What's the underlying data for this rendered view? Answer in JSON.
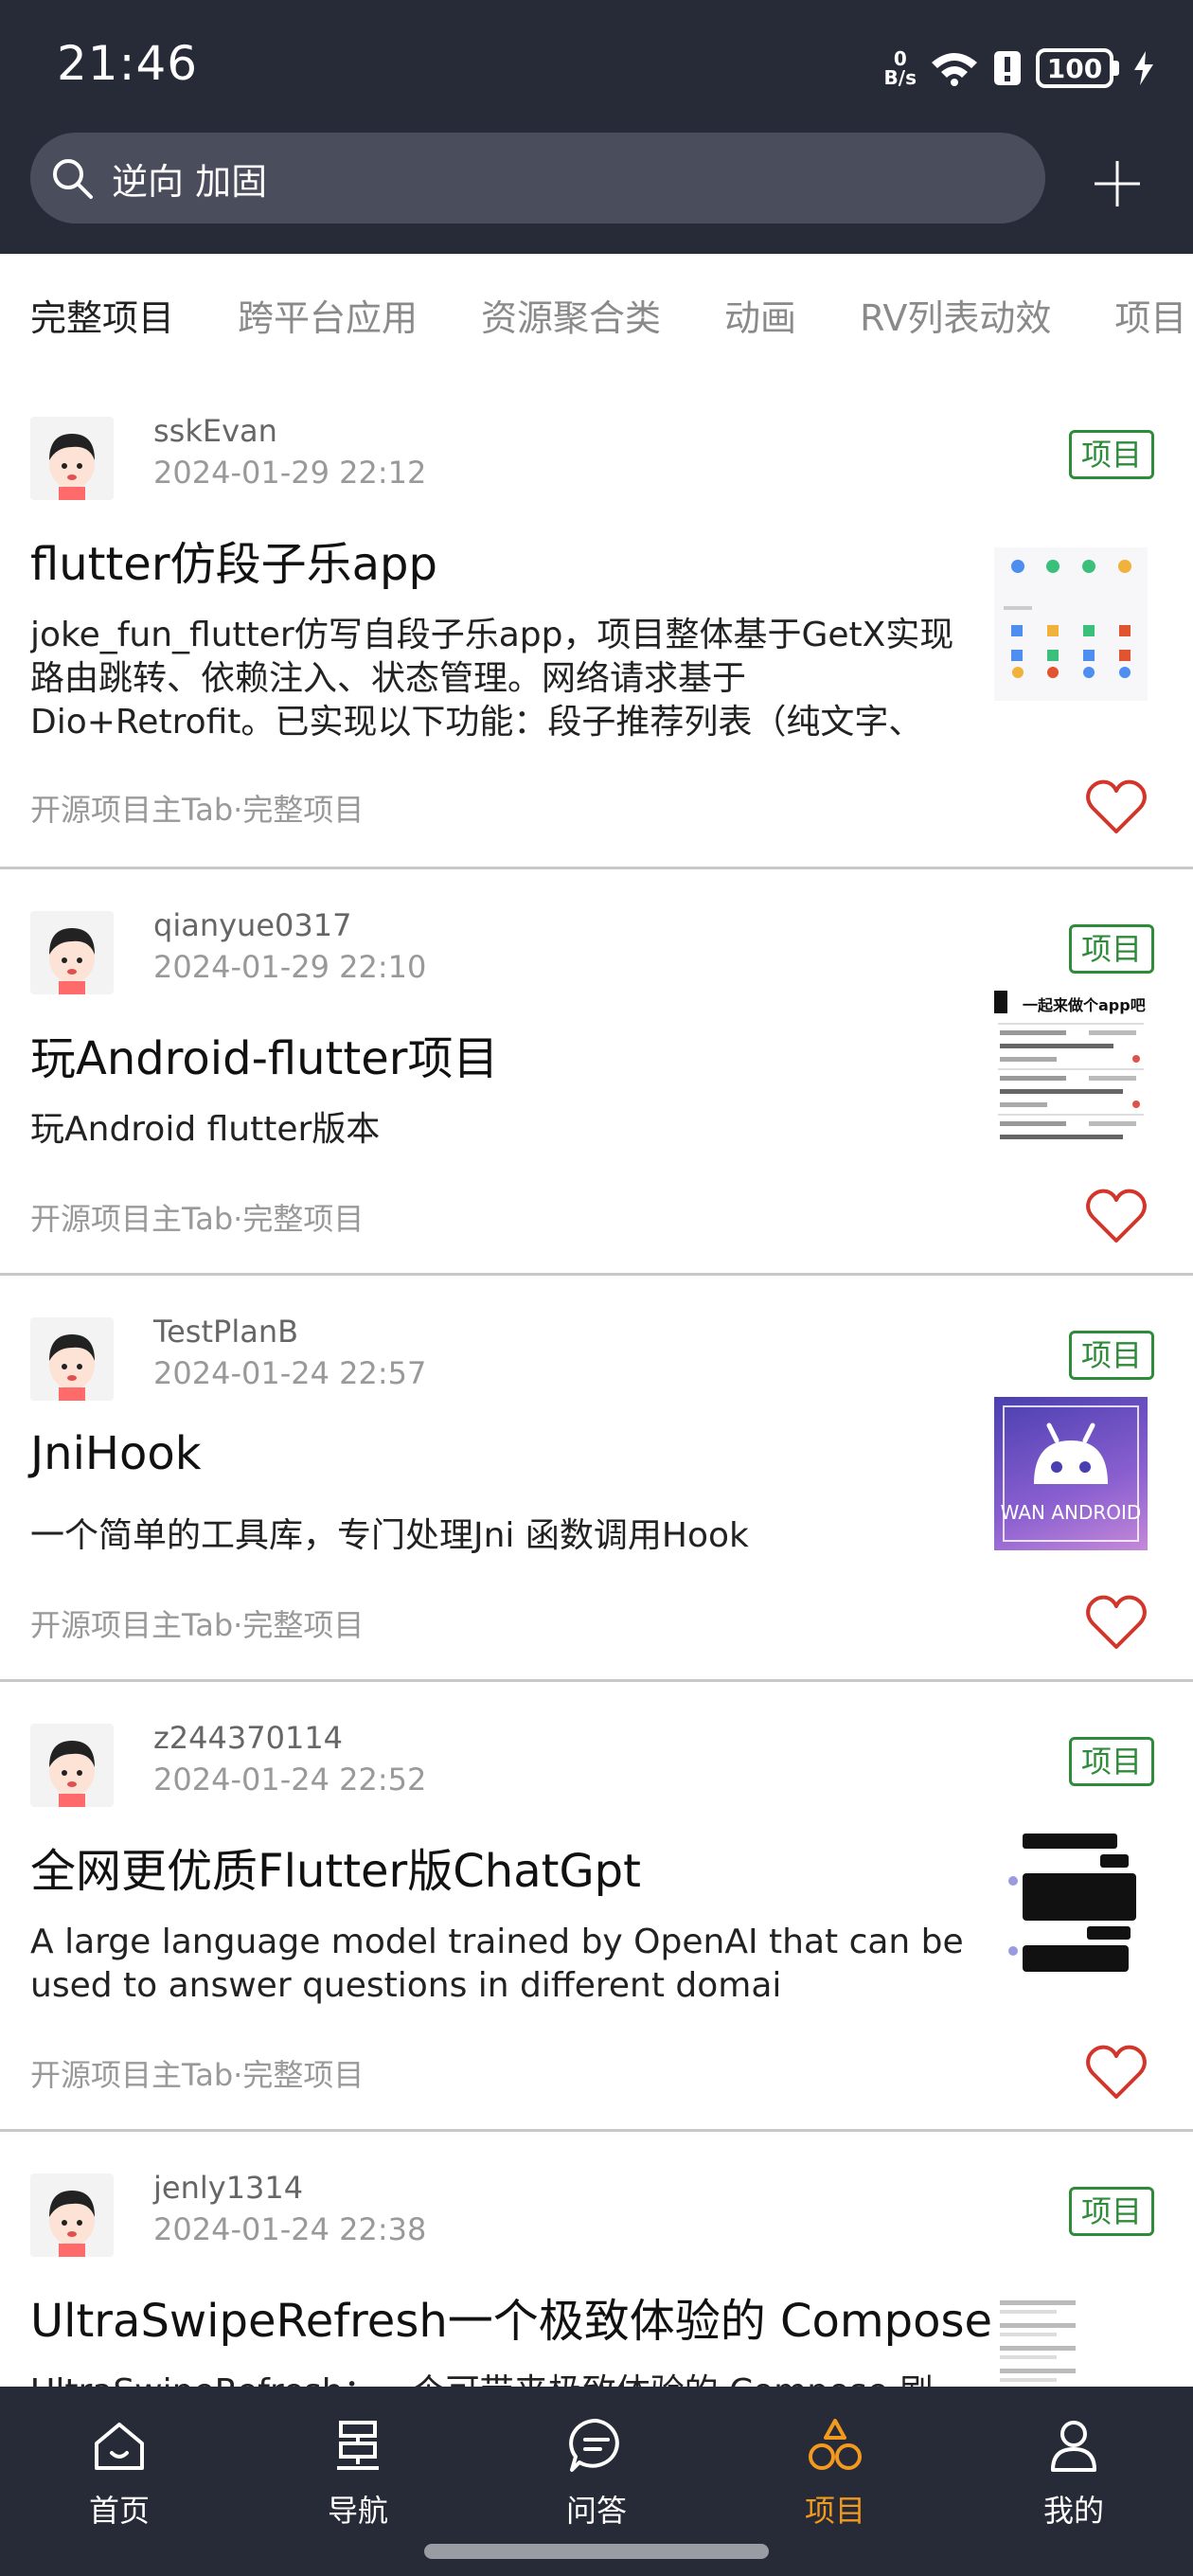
{
  "status_bar": {
    "time": "21:46",
    "net_speed_value": "0",
    "net_speed_unit": "B/s",
    "battery": "100"
  },
  "search": {
    "query": "逆向 加固"
  },
  "tabs": [
    {
      "label": "完整项目",
      "active": true
    },
    {
      "label": "跨平台应用"
    },
    {
      "label": "资源聚合类"
    },
    {
      "label": "动画"
    },
    {
      "label": "RV列表动效"
    },
    {
      "label": "项目"
    }
  ],
  "articles": [
    {
      "author": "sskEvan",
      "date": "2024-01-29 22:12",
      "tag": "项目",
      "title": "flutter仿段子乐app",
      "desc": "joke_fun_flutter仿写自段子乐app，项目整体基于GetX实现路由跳转、依赖注入、状态管理。网络请求基于Dio+Retrofit。已实现以下功能：段子推荐列表（纯文字、",
      "chapter": "开源项目主Tab·完整项目"
    },
    {
      "author": "qianyue0317",
      "date": "2024-01-29 22:10",
      "tag": "项目",
      "title": "玩Android-flutter项目",
      "desc": "玩Android flutter版本",
      "chapter": "开源项目主Tab·完整项目",
      "thumb_text": "一起来做个app吧"
    },
    {
      "author": "TestPlanB",
      "date": "2024-01-24 22:57",
      "tag": "项目",
      "title": "JniHook",
      "desc": "一个简单的工具库，专门处理Jni 函数调用Hook",
      "chapter": "开源项目主Tab·完整项目",
      "thumb_text": "WAN ANDROID"
    },
    {
      "author": "z244370114",
      "date": "2024-01-24 22:52",
      "tag": "项目",
      "title": "全网更优质Flutter版ChatGpt",
      "desc": "A large language model trained by OpenAI that can be used to answer questions in different domai",
      "chapter": "开源项目主Tab·完整项目"
    },
    {
      "author": "jenly1314",
      "date": "2024-01-24 22:38",
      "tag": "项目",
      "title": "UltraSwipeRefresh一个极致体验的 Compose",
      "desc": "UltraSwipeRefresh：一个可带来极致体验的 Compose 刷",
      "chapter": ""
    }
  ],
  "bottom_nav": [
    {
      "label": "首页",
      "icon": "home-icon"
    },
    {
      "label": "导航",
      "icon": "signpost-icon"
    },
    {
      "label": "问答",
      "icon": "chat-bubble-icon"
    },
    {
      "label": "项目",
      "icon": "shapes-icon",
      "active": true
    },
    {
      "label": "我的",
      "icon": "person-icon"
    }
  ],
  "colors": {
    "header_bg": "#272a37",
    "accent": "#f29a1f",
    "tag_green": "#2e8b3a",
    "heart_red": "#d2352a"
  }
}
